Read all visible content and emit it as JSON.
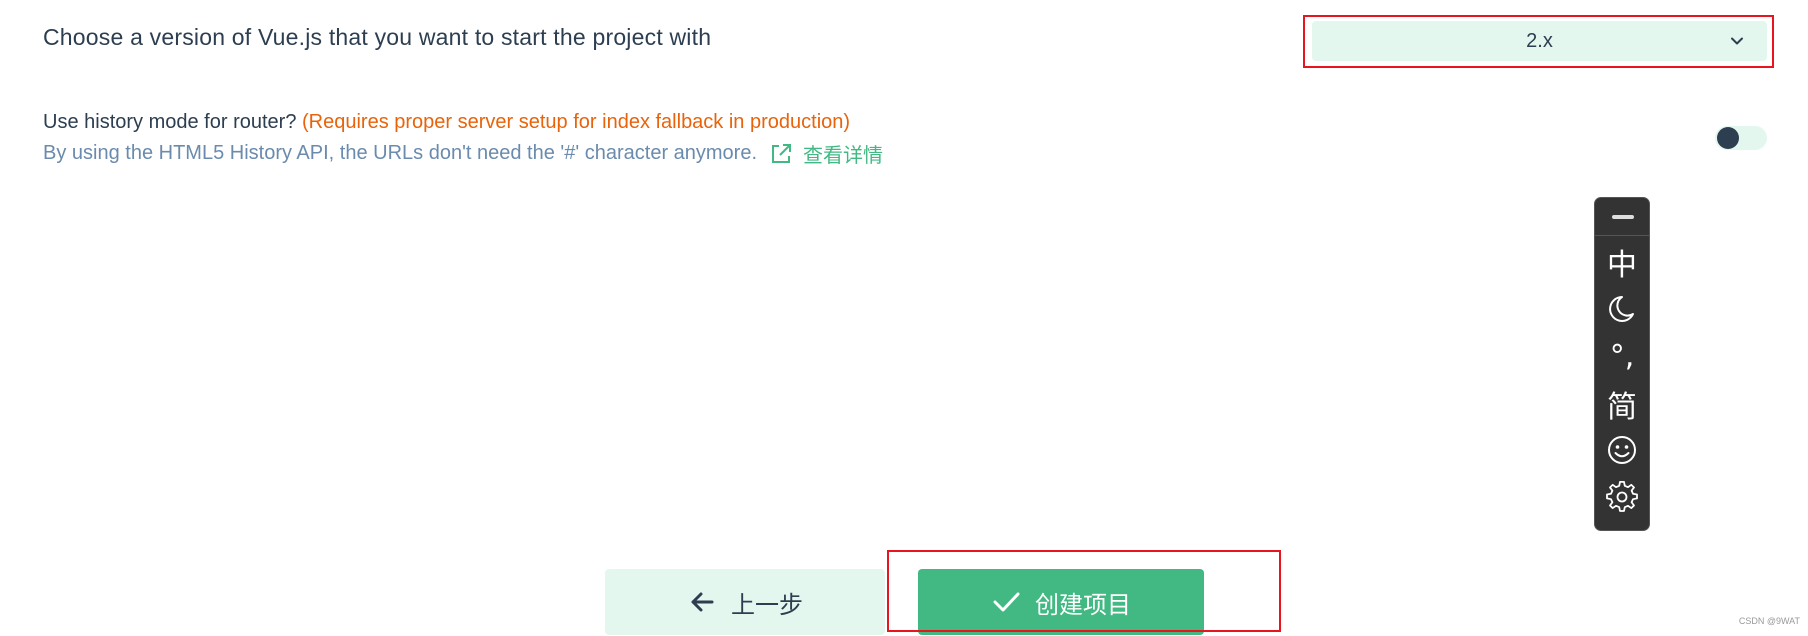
{
  "version": {
    "label": "Choose a version of Vue.js that you want to start the project with",
    "selected": "2.x"
  },
  "history": {
    "title": "Use history mode for router?",
    "warning": "(Requires proper server setup for index fallback in production)",
    "description": "By using the HTML5 History API, the URLs don't need the '#' character anymore.",
    "details_link": "查看详情",
    "toggle_on": false
  },
  "ime": {
    "items": [
      "中",
      "°,",
      "简"
    ],
    "icons": [
      "moon-icon",
      "emoji-icon",
      "gear-icon"
    ]
  },
  "buttons": {
    "prev_label": "上一步",
    "create_label": "创建项目"
  },
  "watermark": "CSDN @9WAT",
  "colors": {
    "accent": "#42b983",
    "accent_light": "#e4f7ee",
    "text": "#2c3e50",
    "muted": "#6a8bad",
    "warning": "#e8630a",
    "highlight": "#e8141e"
  }
}
